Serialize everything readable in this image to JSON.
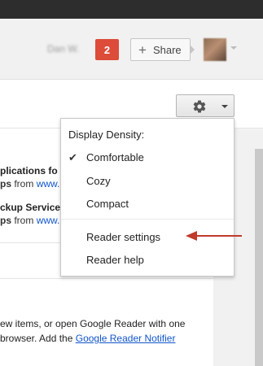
{
  "header": {
    "username": "Dan W.",
    "notification_count": "2",
    "share_label": "Share"
  },
  "items": [
    {
      "title_fragment": "plications fo",
      "sub_prefix": "ps",
      "sub_from": " from ",
      "sub_link": "www."
    },
    {
      "title_fragment": "ckup Service",
      "sub_prefix": "ps",
      "sub_from": " from ",
      "sub_link": "www."
    }
  ],
  "bottom": {
    "line1": "ew items, or open Google Reader with one",
    "line2_prefix": "browser. Add the ",
    "line2_link": "Google Reader Notifier"
  },
  "menu": {
    "heading": "Display Density:",
    "checkmark": "✔",
    "items": [
      "Comfortable",
      "Cozy",
      "Compact",
      "Reader settings",
      "Reader help"
    ]
  },
  "colors": {
    "notification": "#dd4b39",
    "link": "#1155cc",
    "annotation_arrow": "#c0392b"
  }
}
